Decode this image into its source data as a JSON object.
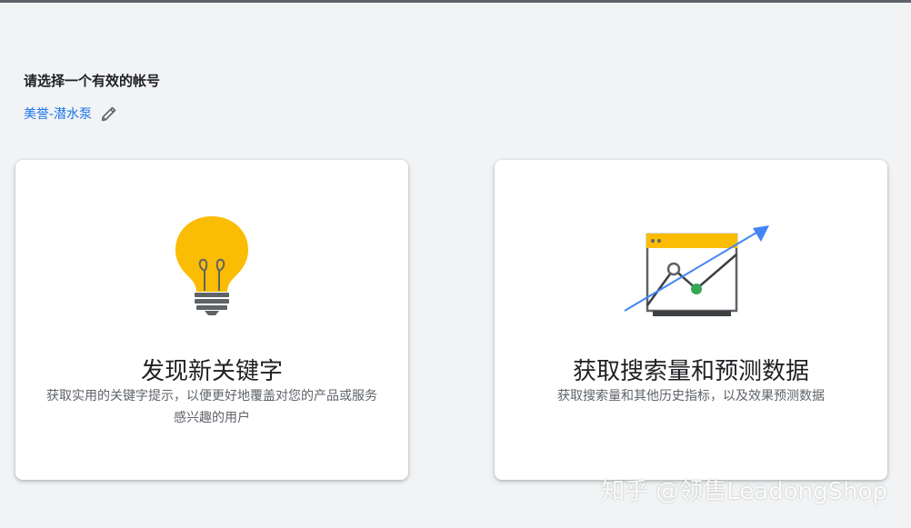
{
  "header": {
    "title": "请选择一个有效的帐号",
    "account_name": "美誉-潜水泵"
  },
  "cards": [
    {
      "title": "发现新关键字",
      "description": "获取实用的关键字提示，以便更好地覆盖对您的产品或服务感兴趣的用户",
      "icon": "lightbulb-icon"
    },
    {
      "title": "获取搜索量和预测数据",
      "description": "获取搜索量和其他历史指标，以及效果预测数据",
      "icon": "growth-chart-icon"
    }
  ],
  "watermark": "知乎 @领售LeadongShop",
  "colors": {
    "page_bg": "#f1f3f4",
    "link": "#1a73e8",
    "bulb": "#fbbc04",
    "arrow": "#4285f4",
    "point_green": "#34a853"
  }
}
